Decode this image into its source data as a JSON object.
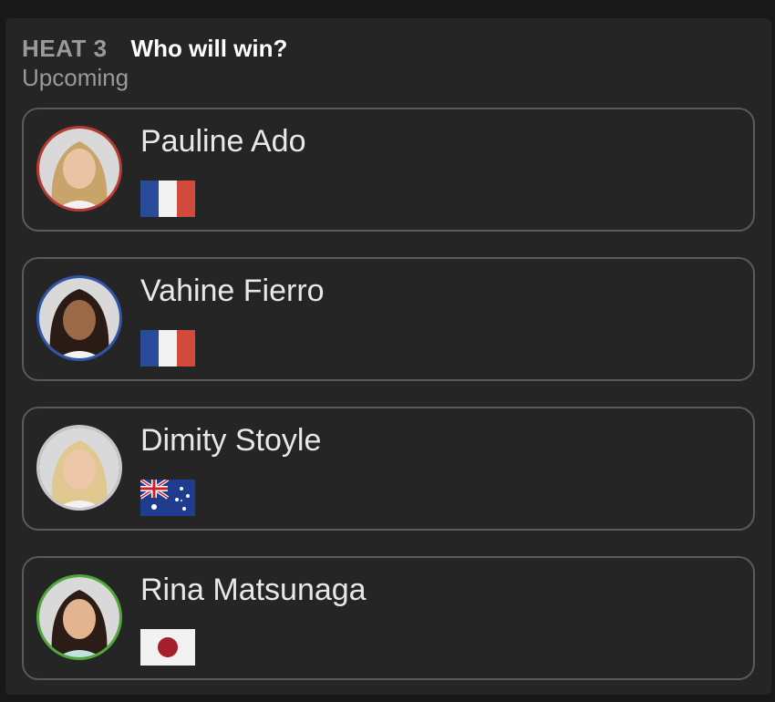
{
  "header": {
    "heat_label": "HEAT 3",
    "question": "Who will win?",
    "status": "Upcoming"
  },
  "surfers": [
    {
      "name": "Pauline Ado",
      "flag": "france-flag",
      "ring_color": "#b83a32",
      "hair_color": "#c9a46a"
    },
    {
      "name": "Vahine Fierro",
      "flag": "france-flag",
      "ring_color": "#2e55a8",
      "hair_color": "#2a1c14"
    },
    {
      "name": "Dimity Stoyle",
      "flag": "australia-flag",
      "ring_color": "#c8c8c8",
      "hair_color": "#e0c890"
    },
    {
      "name": "Rina Matsunaga",
      "flag": "japan-flag",
      "ring_color": "#4fa83a",
      "hair_color": "#2b1d16"
    }
  ]
}
